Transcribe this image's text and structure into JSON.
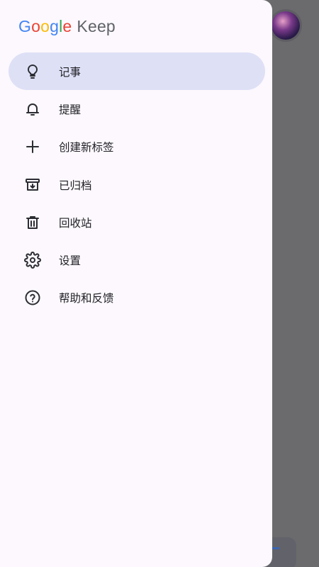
{
  "app": {
    "brand_google": [
      "G",
      "o",
      "o",
      "g",
      "l",
      "e"
    ],
    "brand_product": "Keep"
  },
  "nav": {
    "items": [
      {
        "label": "记事",
        "icon": "lightbulb-icon",
        "active": true
      },
      {
        "label": "提醒",
        "icon": "bell-icon",
        "active": false
      },
      {
        "label": "创建新标签",
        "icon": "plus-icon",
        "active": false
      },
      {
        "label": "已归档",
        "icon": "archive-icon",
        "active": false
      },
      {
        "label": "回收站",
        "icon": "trash-icon",
        "active": false
      },
      {
        "label": "设置",
        "icon": "gear-icon",
        "active": false
      },
      {
        "label": "帮助和反馈",
        "icon": "help-circle-icon",
        "active": false
      }
    ]
  },
  "colors": {
    "drawer_bg": "#fcf8fd",
    "active_item_bg": "#dee0f6",
    "scrim": "#6b6b6e"
  }
}
